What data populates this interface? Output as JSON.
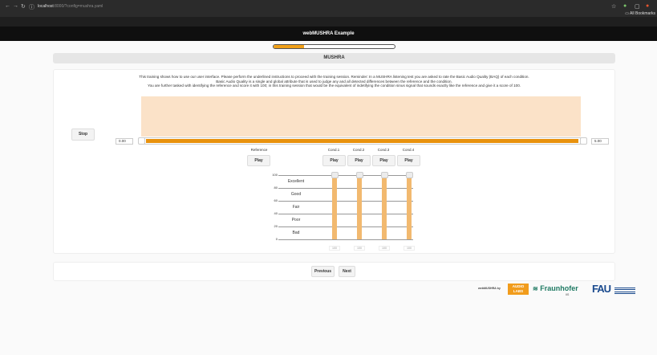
{
  "browser": {
    "url_host": "localhost",
    "url_rest": ":8000/?config=mushra.yaml",
    "bookmarks_label": "All Bookmarks",
    "icons": [
      "back-icon",
      "forward-icon",
      "reload-icon",
      "site-info-icon",
      "star-icon",
      "extensions-icon",
      "profile-icon"
    ]
  },
  "app": {
    "title": "webMUSHRA Example",
    "progress_percent": 25,
    "section_title": "MUSHRA"
  },
  "instructions": {
    "line1": "This training shows how to use our user interface. Please perform the underlined instructions to proceed with the training session. Reminder: In a MUSHRA listening test you are asked to rate the Basic Audio Quality (BAQ) of each condition.",
    "line2": "Basic Audio Quality is a single and global attribute that is used to judge any and all detected differences between the reference and the condition.",
    "line3": "You are further tasked with identifying the reference and score it with 100; in this training session that would be the equivalent of indetifying the condition sinus signal that sounds exactly like the reference and give it a score of 100."
  },
  "player": {
    "stop_label": "Stop",
    "time_start": "0.00",
    "time_end": "5.00"
  },
  "columns": [
    {
      "label": "Reference",
      "play_label": "Play"
    },
    {
      "label": "Cond.1",
      "play_label": "Play"
    },
    {
      "label": "Cond.2",
      "play_label": "Play"
    },
    {
      "label": "Cond.3",
      "play_label": "Play"
    },
    {
      "label": "Cond.4",
      "play_label": "Play"
    }
  ],
  "scale": {
    "ticks": [
      "100",
      "80",
      "60",
      "40",
      "20",
      "0"
    ],
    "labels": [
      "Excellent",
      "Good",
      "Fair",
      "Poor",
      "Bad"
    ]
  },
  "ratings": [
    {
      "value": 100,
      "display": "100"
    },
    {
      "value": 100,
      "display": "100"
    },
    {
      "value": 100,
      "display": "100"
    },
    {
      "value": 100,
      "display": "100"
    }
  ],
  "navigation": {
    "previous_label": "Previous",
    "next_label": "Next"
  },
  "footer": {
    "powered_by": "webMUSHRA by",
    "audiolabs_line1": "AUDIO",
    "audiolabs_line2": "LABS",
    "fraunhofer": "Fraunhofer",
    "fraunhofer_sub": "IIS",
    "fau": "FAU"
  },
  "colors": {
    "accent": "#e8920e",
    "waveform_bg": "#fbe2c8",
    "fader_fill": "#f2b96f"
  }
}
